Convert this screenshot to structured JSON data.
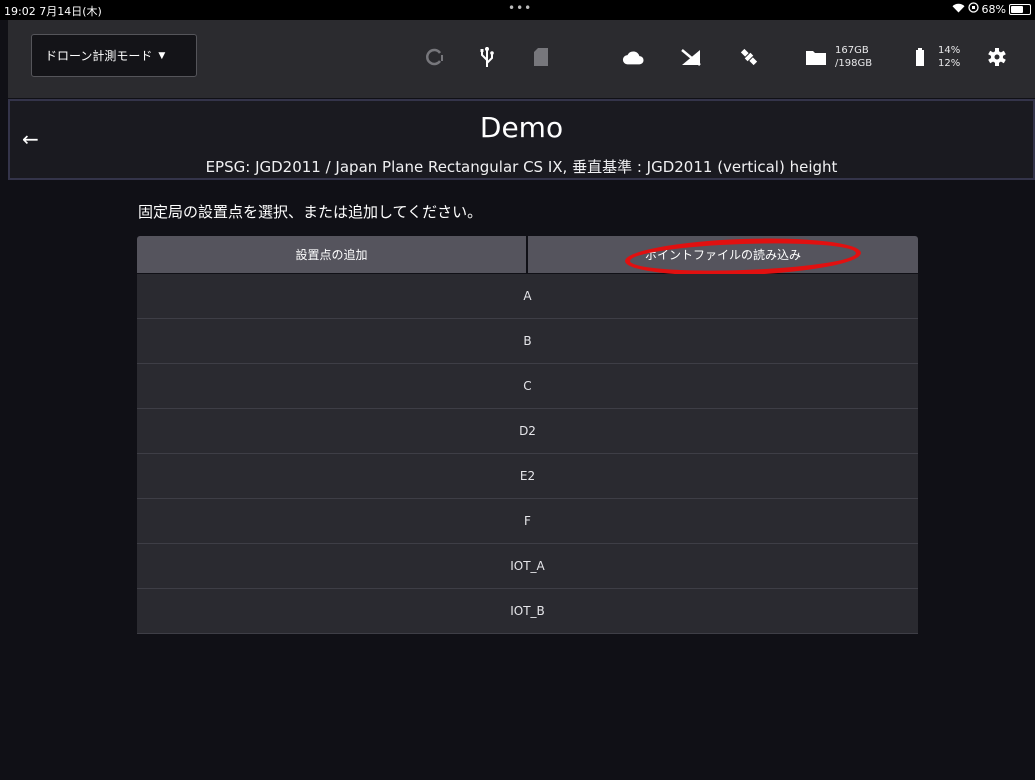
{
  "status_bar": {
    "time": "19:02",
    "date": "7月14日(木)",
    "dots": "•••",
    "battery_percent": "68%"
  },
  "toolbar": {
    "mode_label": "ドローン計測モード",
    "storage_used": "167GB",
    "storage_total": "/198GB",
    "battery_1": "14%",
    "battery_2": "12%"
  },
  "header": {
    "title": "Demo",
    "subtitle": "EPSG: JGD2011 / Japan Plane Rectangular CS IX, 垂直基準 : JGD2011 (vertical) height"
  },
  "instruction": "固定局の設置点を選択、または追加してください。",
  "actions": {
    "add_label": "設置点の追加",
    "load_label": "ポイントファイルの読み込み"
  },
  "points": [
    "A",
    "B",
    "C",
    "D2",
    "E2",
    "F",
    "IOT_A",
    "IOT_B"
  ],
  "colors": {
    "background": "#101016",
    "toolbar": "#2b2b2f",
    "list_row": "#2a2a30",
    "action_button": "#55545d",
    "highlight": "#e11010"
  }
}
